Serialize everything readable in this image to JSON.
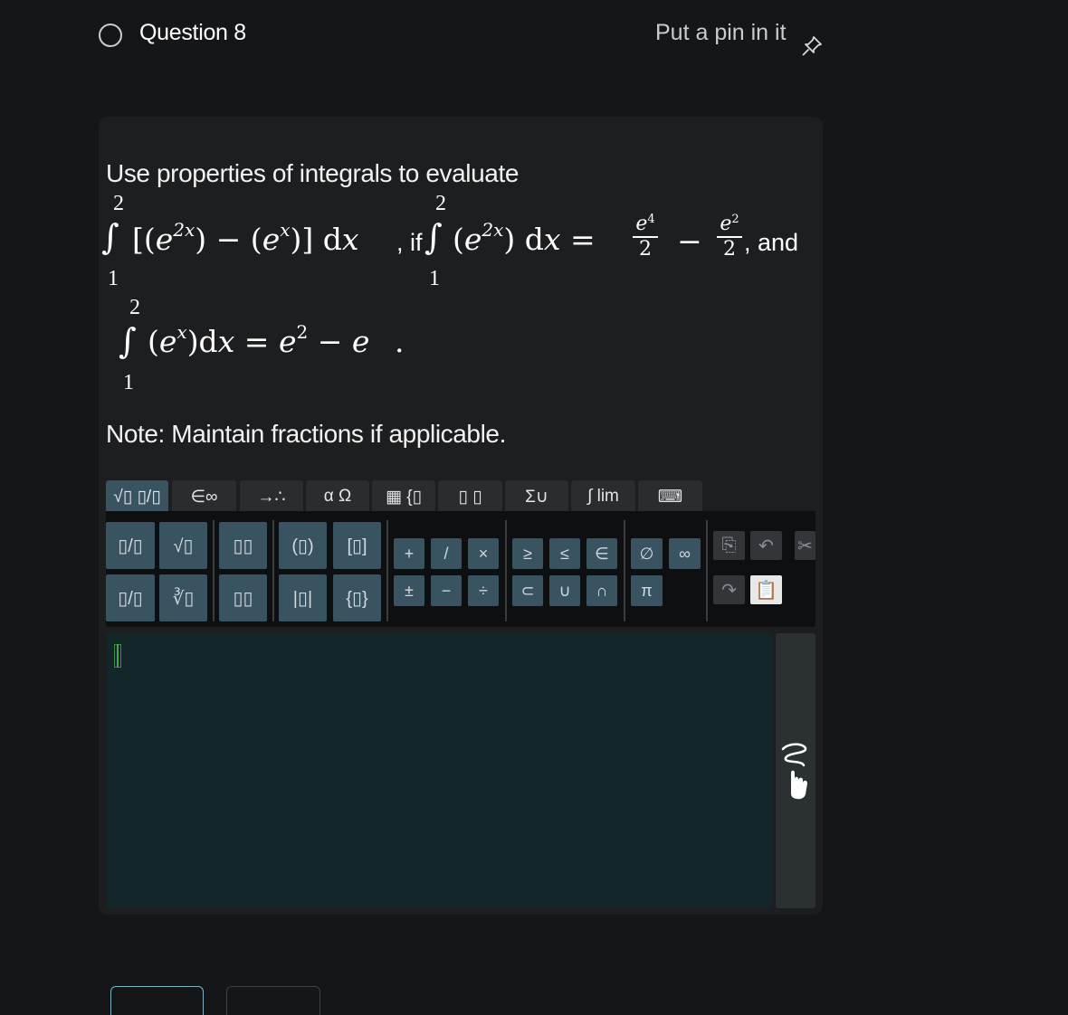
{
  "header": {
    "question_title": "Question 8",
    "pin_label": "Put a pin in it"
  },
  "problem": {
    "prompt": "Use properties of integrals to evaluate",
    "connector_if": ", if",
    "connector_and": ", and",
    "period": ".",
    "note": "Note: Maintain fractions if applicable.",
    "limits": {
      "upper": "2",
      "lower": "1"
    }
  },
  "toolbar": {
    "tabs": [
      "√▯ ▯/▯",
      "∈∞",
      "→∴",
      "α Ω",
      "▦ {▯",
      "▯ ▯",
      "Σ∪",
      "∫ lim",
      "⌨"
    ],
    "keys": {
      "frac": "▯/▯",
      "sqrt": "√▯",
      "power": "▯▯",
      "paren": "(▯)",
      "bracket": "[▯]",
      "plus": "+",
      "slash": "/",
      "times": "×",
      "geq": "≥",
      "leq": "≤",
      "in": "∈",
      "empty": "∅",
      "inf": "∞",
      "mixed": "▯/▯",
      "nroot": "∛▯",
      "sub": "▯▯",
      "abs": "|▯|",
      "brace": "{▯}",
      "pm": "±",
      "minus": "−",
      "div": "÷",
      "subset": "⊂",
      "union": "∪",
      "intersect": "∩",
      "pi": "π"
    }
  },
  "colors": {
    "background": "#151618",
    "card": "#1d1e20",
    "key": "#3a5361",
    "answer_area": "#14262a"
  }
}
